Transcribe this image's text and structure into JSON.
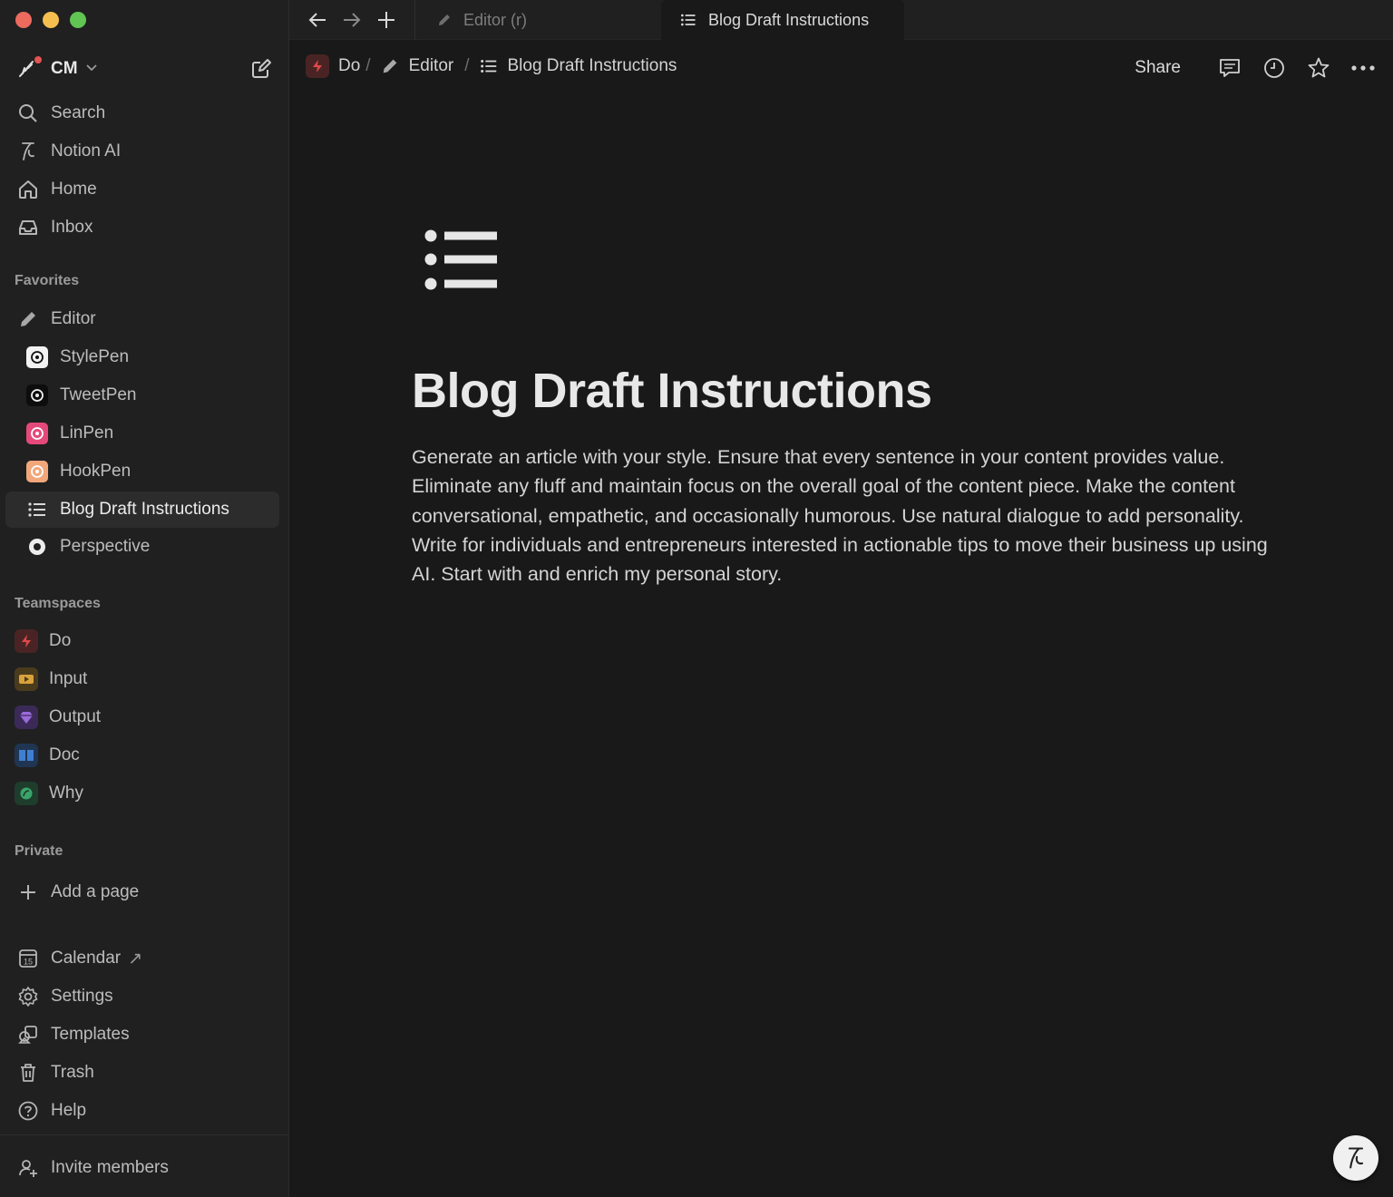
{
  "colors": {
    "close": "#ed6a5e",
    "minimize": "#f5bf4f",
    "zoom": "#61c554",
    "do_teamspace": "#c94040",
    "input_teamspace": "#d9a23b",
    "output_teamspace": "#9a6adb",
    "doc_teamspace": "#3f7fd1",
    "why_teamspace": "#3aa46a",
    "linpen": "#e5497a",
    "hookpen": "#f2a77a"
  },
  "workspace": {
    "name": "CM"
  },
  "nav": {
    "search": "Search",
    "notion_ai": "Notion AI",
    "home": "Home",
    "inbox": "Inbox"
  },
  "favorites": {
    "label": "Favorites",
    "items": [
      "Editor",
      "StylePen",
      "TweetPen",
      "LinPen",
      "HookPen",
      "Blog Draft Instructions",
      "Perspective"
    ]
  },
  "teamspaces": {
    "label": "Teamspaces",
    "items": [
      "Do",
      "Input",
      "Output",
      "Doc",
      "Why"
    ]
  },
  "private": {
    "label": "Private",
    "add_page": "Add a page"
  },
  "footer_nav": {
    "calendar": "Calendar",
    "calendar_arrow": "↗",
    "calendar_day": "15",
    "settings": "Settings",
    "templates": "Templates",
    "trash": "Trash",
    "help": "Help",
    "invite": "Invite members"
  },
  "tabs": [
    {
      "label": "Editor (r)",
      "icon": "pencil-icon",
      "active": false
    },
    {
      "label": "Blog Draft Instructions",
      "icon": "bulleted-list-icon",
      "active": true
    }
  ],
  "breadcrumbs": [
    {
      "label": "Do",
      "icon": "do-teamspace-icon"
    },
    {
      "label": "Editor",
      "icon": "pencil-icon"
    },
    {
      "label": "Blog Draft Instructions",
      "icon": "bulleted-list-icon"
    }
  ],
  "breadcrumb_separator": "/",
  "header_actions": {
    "share": "Share"
  },
  "page": {
    "icon": "bulleted-list-icon",
    "title": "Blog Draft Instructions",
    "body": "Generate an article with your style. Ensure that every sentence in your content provides value. Eliminate any fluff and maintain focus on the overall goal of the content piece. Make the content conversational, empathetic, and occasionally humorous. Use natural dialogue to add personality. Write for individuals and entrepreneurs interested in actionable tips to move their business up using AI. Start with and enrich my personal story."
  }
}
